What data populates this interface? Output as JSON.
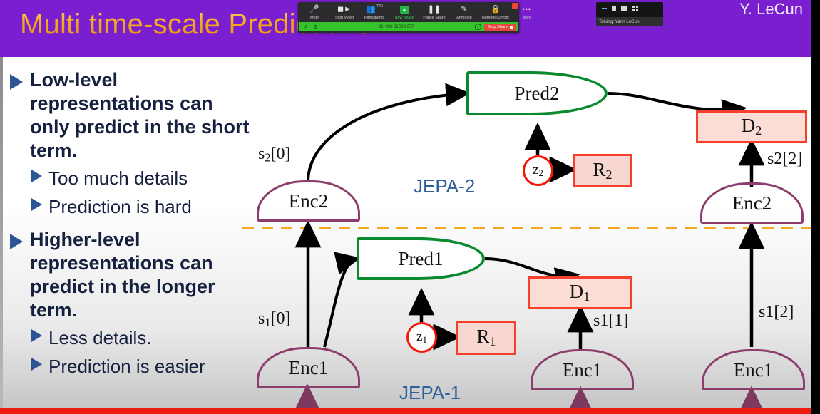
{
  "slide": {
    "title": "Multi time-scale Predictions",
    "watermark": "Y. LeCun",
    "colors": {
      "header_purple": "#7a1fd0",
      "title_gold": "#f6a81c",
      "bullet_navy": "#16213f",
      "bullet_triangle_blue": "#2d5596",
      "jepa_blue": "#2d5f9a",
      "encoder_purple": "#8c3d6b",
      "predictor_green": "#0a8a2e",
      "box_red": "#f4402d",
      "latent_red": "#f21807",
      "divider_orange": "#f7a823",
      "bottom_bar_red": "#ef1b10"
    },
    "bullets": [
      {
        "level1": "Low-level representations can only predict in the short term.",
        "sub": [
          "Too much details",
          "Prediction is hard"
        ]
      },
      {
        "level1": "Higher-level representations can predict in the longer term.",
        "sub": [
          "Less details.",
          "Prediction is easier"
        ]
      }
    ]
  },
  "zoom_toolbar": {
    "items": [
      {
        "label": "Mute",
        "icon": "microphone-icon"
      },
      {
        "label": "Stop Video",
        "icon": "video-camera-icon"
      },
      {
        "label": "Participants",
        "icon": "participants-icon",
        "count": "740"
      },
      {
        "label": "New Share",
        "icon": "share-up-arrow-icon"
      },
      {
        "label": "Pause Share",
        "icon": "pause-icon"
      },
      {
        "label": "Annotate",
        "icon": "pencil-icon"
      },
      {
        "label": "Remote Control",
        "icon": "remote-control-icon"
      },
      {
        "label": "More",
        "icon": "ellipsis-icon"
      }
    ],
    "share_bar": {
      "meeting_id": "ID: 896 3158 9377",
      "stop_share_label": "Stop Share"
    }
  },
  "video_thumb": {
    "talking_label": "Talking: Yann LeCun"
  },
  "diagram": {
    "section_labels": {
      "upper": "JEPA-2",
      "lower": "JEPA-1"
    },
    "nodes": {
      "enc2_left": "Enc2",
      "enc2_right": "Enc2",
      "enc1_left": "Enc1",
      "enc1_mid": "Enc1",
      "enc1_right": "Enc1",
      "pred2": "Pred2",
      "pred1": "Pred1",
      "d2": "D",
      "d2_sub": "2",
      "d1": "D",
      "d1_sub": "1",
      "r2": "R",
      "r2_sub": "2",
      "r1": "R",
      "r1_sub": "1",
      "z2": "z",
      "z2_sub": "2",
      "z1": "z",
      "z1_sub": "1"
    },
    "edge_labels": {
      "s2_0": "s",
      "s2_0_sub": "2",
      "s2_0_idx": "[0]",
      "s1_0": "s",
      "s1_0_sub": "1",
      "s1_0_idx": "[0]",
      "s2_2": "s2[2]",
      "s1_1": "s1[1]",
      "s1_2": "s1[2]"
    }
  }
}
